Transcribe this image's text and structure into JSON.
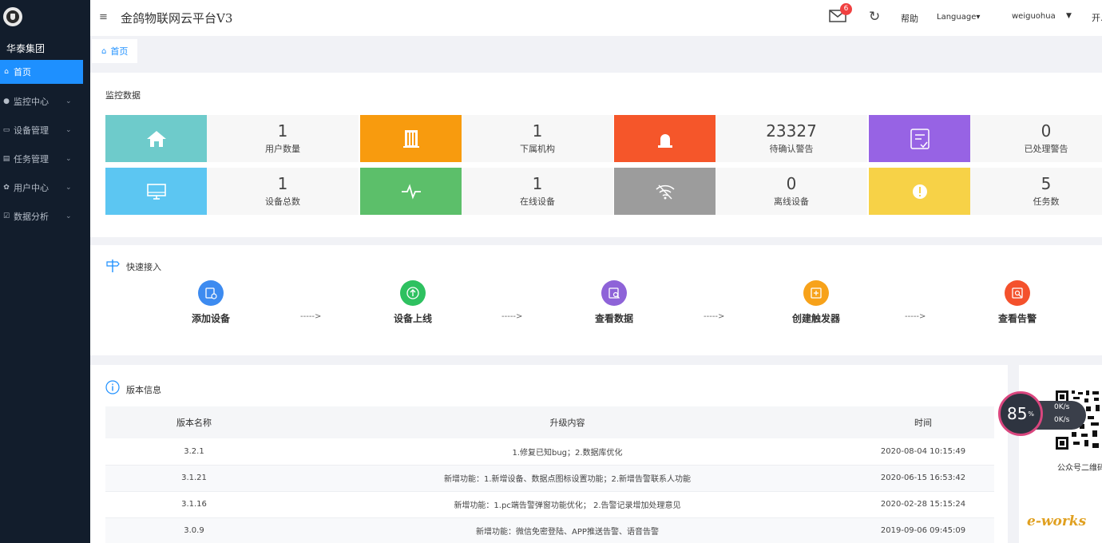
{
  "sidebar": {
    "org": "华泰集团",
    "items": [
      {
        "label": "首页",
        "icon": "home-icon",
        "glyph": "⌂"
      },
      {
        "label": "监控中心",
        "icon": "bulb-icon",
        "glyph": "●"
      },
      {
        "label": "设备管理",
        "icon": "monitor-icon",
        "glyph": "▭"
      },
      {
        "label": "任务管理",
        "icon": "list-icon",
        "glyph": "▤"
      },
      {
        "label": "用户中心",
        "icon": "gear-icon",
        "glyph": "✿"
      },
      {
        "label": "数据分析",
        "icon": "edit-icon",
        "glyph": "☑"
      }
    ]
  },
  "header": {
    "menu_glyph": "≡",
    "title": "金鸽物联网云平台V3",
    "mail_badge": "6",
    "refresh_glyph": "↻",
    "help": "帮助",
    "language": "Language▾",
    "user": "weiguohua",
    "user_caret": "▼",
    "open": "开..."
  },
  "breadcrumb": {
    "home_glyph": "⌂",
    "label": "首页"
  },
  "monitor": {
    "title": "监控数据",
    "tiles": [
      {
        "value": "1",
        "label": "用户数量",
        "color": "#6ecbcb",
        "icon": "house-icon"
      },
      {
        "value": "1",
        "label": "下属机构",
        "color": "#f89b0e",
        "icon": "building-icon"
      },
      {
        "value": "23327",
        "label": "待确认警告",
        "color": "#f5562a",
        "icon": "alarm-icon"
      },
      {
        "value": "0",
        "label": "已处理警告",
        "color": "#9763e4",
        "icon": "document-check-icon"
      },
      {
        "value": "1",
        "label": "设备总数",
        "color": "#5cc6f2",
        "icon": "monitor-icon"
      },
      {
        "value": "1",
        "label": "在线设备",
        "color": "#5cbf6a",
        "icon": "pulse-icon"
      },
      {
        "value": "0",
        "label": "离线设备",
        "color": "#9c9c9c",
        "icon": "wifi-off-icon"
      },
      {
        "value": "5",
        "label": "任务数",
        "color": "#f7d247",
        "icon": "exclamation-icon"
      }
    ]
  },
  "quick": {
    "title": "快速接入",
    "steps": [
      {
        "label": "添加设备",
        "color": "#3d8bf0",
        "icon": "add-device-icon"
      },
      {
        "label": "设备上线",
        "color": "#2ec160",
        "icon": "upload-icon"
      },
      {
        "label": "查看数据",
        "color": "#8e63d8",
        "icon": "view-data-icon"
      },
      {
        "label": "创建触发器",
        "color": "#f7a21a",
        "icon": "trigger-icon"
      },
      {
        "label": "查看告警",
        "color": "#f4512c",
        "icon": "view-alarm-icon"
      }
    ],
    "arrow": "----->"
  },
  "version": {
    "title": "版本信息",
    "columns": [
      "版本名称",
      "升级内容",
      "时间"
    ],
    "rows": [
      [
        "3.2.1",
        "1.修复已知bug；2.数据库优化",
        "2020-08-04 10:15:49"
      ],
      [
        "3.1.21",
        "新增功能：1.新增设备、数据点图标设置功能；2.新增告警联系人功能",
        "2020-06-15 16:53:42"
      ],
      [
        "3.1.16",
        "新增功能：1.pc端告警弹窗功能优化； 2.告警记录增加处理意见",
        "2020-02-28 15:15:24"
      ],
      [
        "3.0.9",
        "新增功能：微信免密登陆、APP推送告警、语音告警",
        "2019-09-06 09:45:09"
      ]
    ]
  },
  "qr": {
    "caption": "公众号二维码",
    "brand": "e-works"
  },
  "speed": {
    "percent": "85",
    "unit": "%",
    "up": "0K/s",
    "down": "0K/s"
  }
}
